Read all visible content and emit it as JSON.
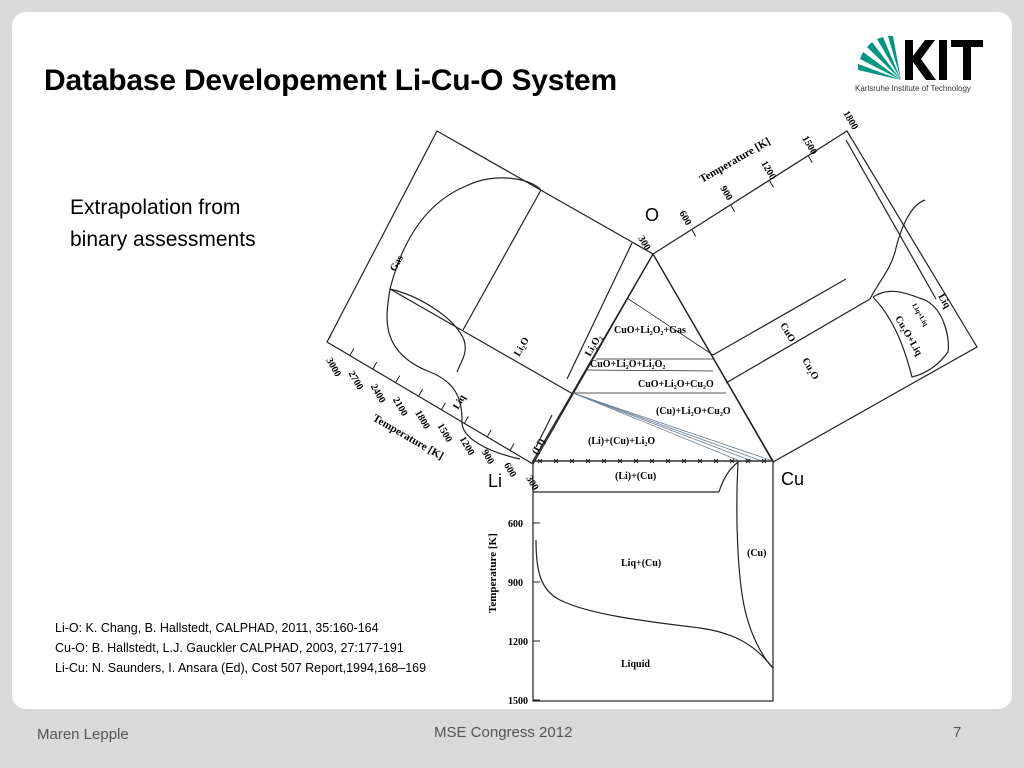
{
  "slide": {
    "title": "Database Developement Li-Cu-O System",
    "subtitle_lines": [
      "Extrapolation from",
      "binary assessments"
    ]
  },
  "logo": {
    "text": "KIT",
    "caption": "Karlsruhe Institute of Technology",
    "color": "#009682"
  },
  "diagram": {
    "corners": {
      "O": "O",
      "Li": "Li",
      "Cu": "Cu"
    },
    "ternary_regions": [
      "CuO+Li₂O₂+Gas",
      "CuO+Li₂O+Li₂O₂",
      "CuO+Li₂O+Cu₂O",
      "(Cu)+Li₂O+Cu₂O",
      "(Li)+(Cu)+Li₂O"
    ],
    "li_o_panel": {
      "axis_title": "Temperature [K]",
      "ticks": [
        "300",
        "600",
        "900",
        "1200",
        "1500",
        "1800",
        "2100",
        "2400",
        "2700",
        "3000"
      ],
      "phases": [
        "Gas",
        "Li₂O",
        "Li₂O₂",
        "Liq",
        "(Li)"
      ]
    },
    "cu_o_panel": {
      "axis_title": "Temperature [K]",
      "ticks": [
        "300",
        "600",
        "900",
        "1200",
        "1500",
        "1800"
      ],
      "phases": [
        "CuO",
        "Cu₂O",
        "Cu₂O+Liq",
        "Liq+Liq",
        "Liq"
      ]
    },
    "li_cu_panel": {
      "axis_title": "Temperature [K]",
      "ticks": [
        "600",
        "900",
        "1200",
        "1500"
      ],
      "phases": [
        "(Li)+(Cu)",
        "Liq+(Cu)",
        "(Cu)",
        "Liquid"
      ]
    }
  },
  "references": [
    "Li-O:  K. Chang, B. Hallstedt, CALPHAD, 2011, 35:160-164",
    "Cu-O: B. Hallstedt, L.J. Gauckler CALPHAD, 2003, 27:177-191",
    "Li-Cu: N. Saunders, I. Ansara (Ed), Cost 507 Report,1994,168–169"
  ],
  "footer": {
    "author": "Maren Lepple",
    "event": "MSE Congress 2012",
    "page": "7"
  }
}
